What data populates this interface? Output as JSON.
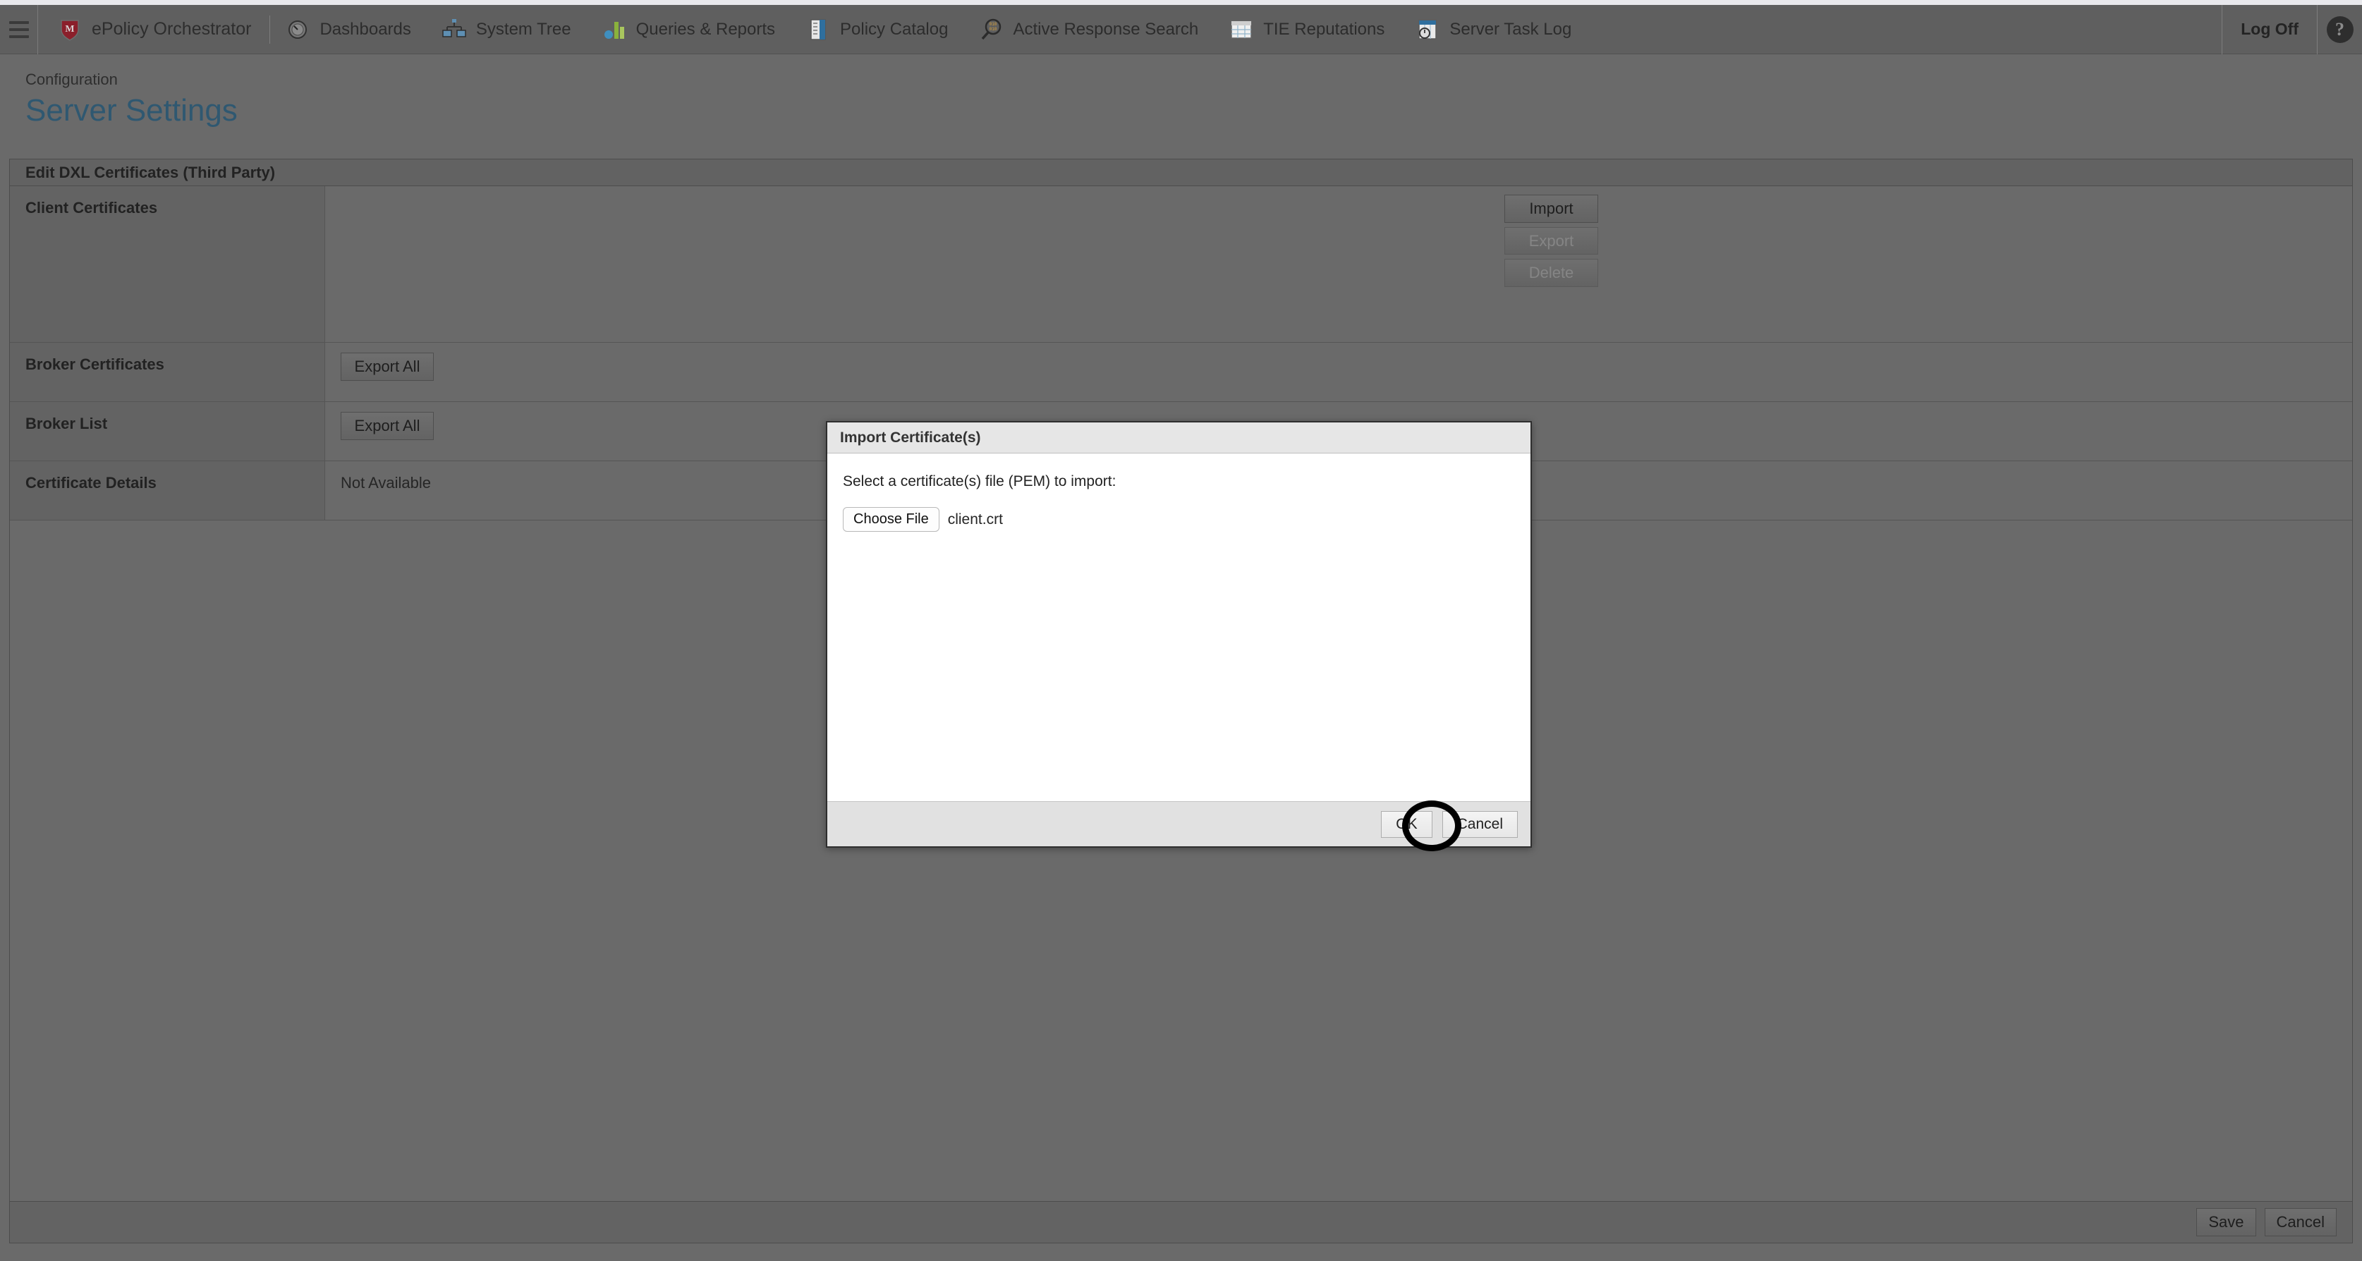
{
  "navbar": {
    "hamburger_label": "menu",
    "brand": "ePolicy Orchestrator",
    "items": [
      {
        "label": "Dashboards",
        "icon": "gauge-icon"
      },
      {
        "label": "System Tree",
        "icon": "system-tree-icon"
      },
      {
        "label": "Queries & Reports",
        "icon": "bar-chart-icon"
      },
      {
        "label": "Policy Catalog",
        "icon": "notebook-icon"
      },
      {
        "label": "Active Response Search",
        "icon": "magnifier-binary-icon"
      },
      {
        "label": "TIE Reputations",
        "icon": "table-grid-icon"
      },
      {
        "label": "Server Task Log",
        "icon": "clock-log-icon"
      }
    ],
    "log_off": "Log Off",
    "help": "?"
  },
  "page": {
    "breadcrumb": "Configuration",
    "title": "Server Settings",
    "title_color": "#2f5871"
  },
  "panel": {
    "header": "Edit DXL Certificates (Third Party)",
    "rows": [
      {
        "label": "Client Certificates",
        "buttons": [
          {
            "label": "Import",
            "disabled": false
          },
          {
            "label": "Export",
            "disabled": true
          },
          {
            "label": "Delete",
            "disabled": true
          }
        ]
      },
      {
        "label": "Broker Certificates",
        "button": "Export All"
      },
      {
        "label": "Broker List",
        "button": "Export All"
      },
      {
        "label": "Certificate Details",
        "value": "Not Available"
      }
    ]
  },
  "bottom_bar": {
    "save": "Save",
    "cancel": "Cancel"
  },
  "modal": {
    "title": "Import Certificate(s)",
    "instruction": "Select a certificate(s) file (PEM) to import:",
    "choose_file_label": "Choose File",
    "file_name": "client.crt",
    "ok": "OK",
    "cancel": "Cancel"
  },
  "annotation": {
    "target": "OK",
    "shape": "ellipse",
    "color": "#000000"
  }
}
